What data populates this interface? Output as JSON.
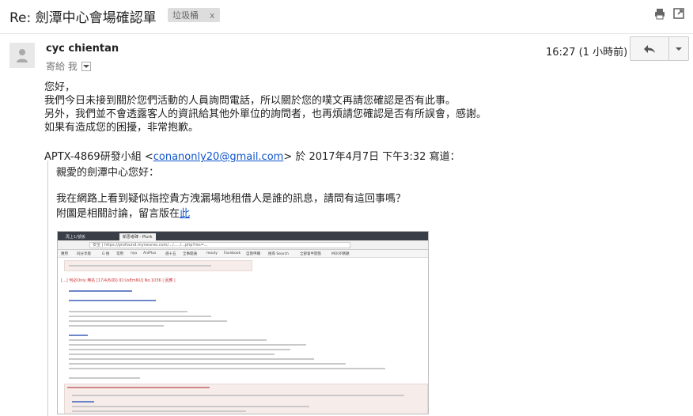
{
  "header": {
    "subject": "Re: 劍潭中心會場確認單",
    "label": "垃圾桶",
    "label_remove": "x"
  },
  "message": {
    "sender_name": "cyc chientan",
    "to_prefix": "寄給 我",
    "time": "16:27 (1 小時前)",
    "body_lines": [
      "您好，",
      " 我們今日未接到關於您們活動的人員詢問電話，所以關於您的噗文再請您確認是否有此事。",
      "另外，我們並不會透露客人的資訊給其他外單位的詢問者，也再煩請您確認是否有所誤會，感謝。",
      "如果有造成您的困擾，非常抱歉。"
    ]
  },
  "quote": {
    "header_prefix": "APTX-4869研發小組 <",
    "email": "conanonly20@gmail.com",
    "header_suffix": "> 於 2017年4月7日 下午3:32 寫道：",
    "greeting": "親愛的劍潭中心您好：",
    "line1": "我在網路上看到疑似指控貴方洩漏場地租借人是誰的訊息，請問有這回事嗎？",
    "line2_prefix": "附圖是相關討論，留言版在",
    "line2_link": "此"
  },
  "screenshot": {
    "tab1": "再上1/號板",
    "tab2": "新思考碑 - Plurk",
    "url": "安全 | https://profound.myneuroo.com/.../...../...php?res=...",
    "bookmarks": [
      "應用",
      "同分享版",
      "G 搜",
      "常用",
      "nyu",
      "AniPlus",
      "週十五",
      "全事開通",
      "mouly",
      "Facebook",
      "自我申購",
      "搜尋 Search",
      "全部會半開張",
      "MOOF精題"
    ],
    "post_title": "[...] 何必Only 無名 [17/4/6(四) ID:UsEmNU] No.1036 | 回應 |"
  },
  "colors": {
    "link": "#1155cc",
    "chip_bg": "#dddddd"
  }
}
